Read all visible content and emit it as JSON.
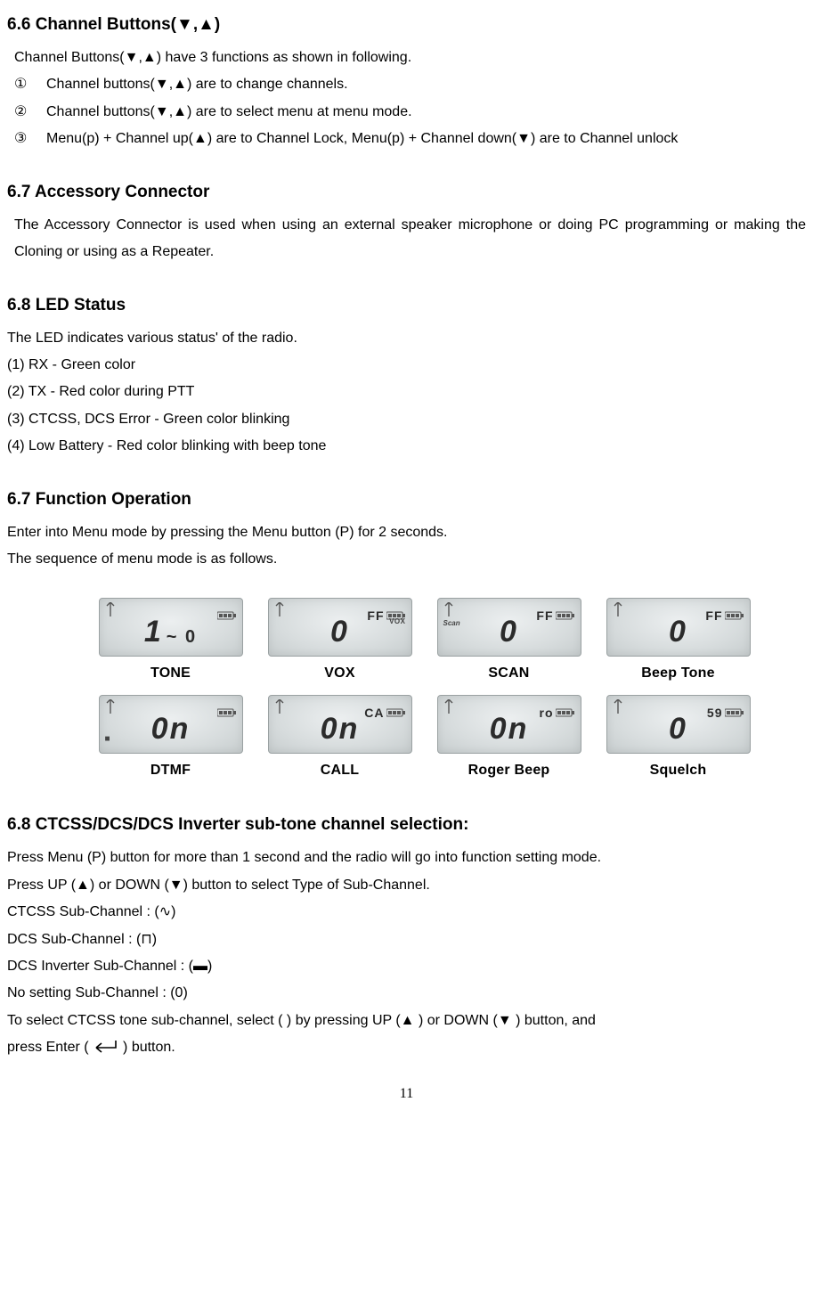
{
  "section66": {
    "heading": "6.6 Channel Buttons(▼,▲)",
    "intro": "Channel Buttons(▼,▲) have 3 functions as shown in following.",
    "items": [
      {
        "marker": "①",
        "text": "Channel buttons(▼,▲) are to change channels."
      },
      {
        "marker": "②",
        "text": "Channel buttons(▼,▲) are to select menu at menu mode."
      },
      {
        "marker": "③",
        "text": "Menu(p) + Channel up(▲) are to Channel Lock, Menu(p) + Channel down(▼) are to Channel unlock"
      }
    ]
  },
  "section67a": {
    "heading": "6.7 Accessory Connector",
    "body": "The Accessory Connector is used when using an external speaker microphone or doing PC programming or making the Cloning or using as a Repeater."
  },
  "section68a": {
    "heading": "6.8 LED Status",
    "intro": "The LED indicates various status' of the radio.",
    "items": [
      "(1) RX - Green color",
      "(2) TX - Red color during PTT",
      "(3) CTCSS, DCS Error - Green color blinking",
      "(4) Low Battery - Red color blinking with beep tone"
    ]
  },
  "section67b": {
    "heading": "6.7 Function Operation",
    "line1": "Enter into Menu mode by pressing the Menu button (P) for 2 seconds.",
    "line2": "The sequence of menu mode is as follows."
  },
  "menus": [
    {
      "caption": "TONE",
      "big": "1",
      "sub": "~ 0",
      "corner": "",
      "left": "",
      "scan": "",
      "sup": ""
    },
    {
      "caption": "VOX",
      "big": "0",
      "sub": "",
      "corner": "VOX",
      "left": "",
      "scan": "",
      "sup": "FF"
    },
    {
      "caption": "SCAN",
      "big": "0",
      "sub": "",
      "corner": "",
      "left": "",
      "scan": "Scan",
      "sup": "FF"
    },
    {
      "caption": "Beep Tone",
      "big": "0",
      "sub": "",
      "corner": "",
      "left": "",
      "scan": "",
      "sup": "FF"
    },
    {
      "caption": "DTMF",
      "big": "0n",
      "sub": "",
      "corner": "",
      "left": "■",
      "scan": "",
      "sup": ""
    },
    {
      "caption": "CALL",
      "big": "0n",
      "sub": "",
      "corner": "",
      "left": "",
      "scan": "",
      "sup": "CA"
    },
    {
      "caption": "Roger Beep",
      "big": "0n",
      "sub": "",
      "corner": "",
      "left": "",
      "scan": "",
      "sup": "ro"
    },
    {
      "caption": "Squelch",
      "big": "0",
      "sub": "",
      "corner": "",
      "left": "",
      "scan": "",
      "sup": "59"
    }
  ],
  "section68b": {
    "heading": "6.8 CTCSS/DCS/DCS Inverter sub-tone channel selection:",
    "lines": [
      "Press Menu (P) button for more than 1 second and the radio will go into function setting mode.",
      "Press UP (▲) or DOWN (▼) button to select Type of Sub-Channel.",
      "CTCSS Sub-Channel : (∿)",
      "DCS Sub-Channel : (⊓)",
      "DCS Inverter Sub-Channel : (▬)",
      "No setting Sub-Channel : (0)",
      "To select CTCSS tone sub-channel, select ( ) by pressing UP (▲ ) or DOWN (▼ ) button, and"
    ],
    "lastline_prefix": "press Enter (",
    "lastline_suffix": " ) button."
  },
  "icons": {
    "antenna": "antenna-icon",
    "battery": "battery-icon",
    "enter": "enter-key-icon"
  },
  "pagenum": "11"
}
